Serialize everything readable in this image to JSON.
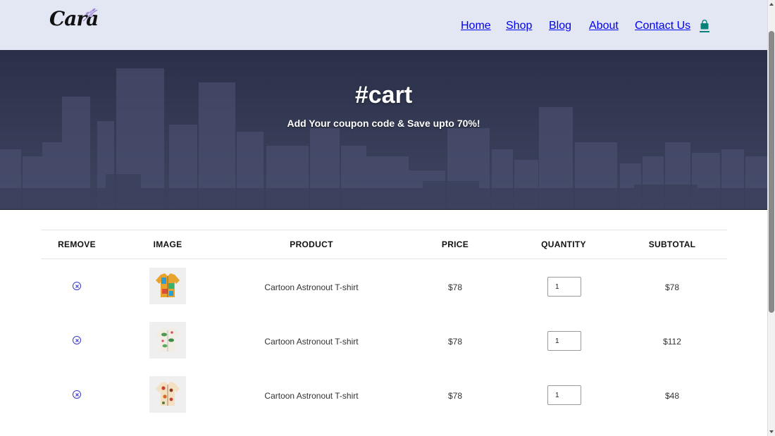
{
  "header": {
    "logo_text": "Cara",
    "nav": [
      {
        "label": "Home"
      },
      {
        "label": "Shop"
      },
      {
        "label": "Blog"
      },
      {
        "label": "About"
      },
      {
        "label": "Contact Us"
      }
    ],
    "cart_icon": "shopping-bag-icon",
    "accent_color": "#088178"
  },
  "hero": {
    "title": "#cart",
    "subtitle": "Add Your coupon code & Save upto 70%!"
  },
  "cart": {
    "columns": [
      "REMOVE",
      "IMAGE",
      "PRODUCT",
      "PRICE",
      "QUANTITY",
      "SUBTOTAL"
    ],
    "remove_icon": "circle-x-icon",
    "rows": [
      {
        "product": "Cartoon Astronout T-shirt",
        "price": "$78",
        "quantity": "1",
        "subtotal": "$78",
        "image_icon": "patterned-shirt-icon"
      },
      {
        "product": "Cartoon Astronout T-shirt",
        "price": "$78",
        "quantity": "1",
        "subtotal": "$112",
        "image_icon": "floral-shirt-icon"
      },
      {
        "product": "Cartoon Astronout T-shirt",
        "price": "$78",
        "quantity": "1",
        "subtotal": "$48",
        "image_icon": "printed-shirt-icon"
      }
    ]
  }
}
